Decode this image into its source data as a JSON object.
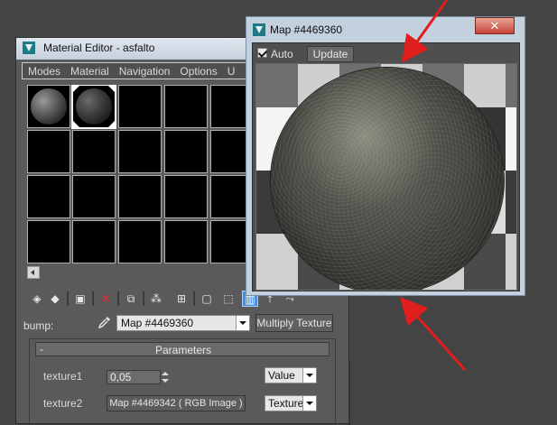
{
  "material_editor": {
    "title": "Material Editor - asfalto",
    "menu": [
      "Modes",
      "Material",
      "Navigation",
      "Options",
      "U"
    ],
    "bump_label": "bump:",
    "map_dropdown_value": "Map #4469360",
    "multiply_button": "Multiply Texture",
    "parameters": {
      "header_toggle": "-",
      "header_title": "Parameters",
      "texture1_label": "texture1",
      "texture1_value": "0,05",
      "texture1_mode": "Value",
      "texture2_label": "texture2",
      "texture2_map": "Map #4469342  ( RGB Image )",
      "texture2_mode": "Texture"
    }
  },
  "map_window": {
    "title": "Map #4469360",
    "close_glyph": "✕",
    "auto_label": "Auto",
    "auto_checked": true,
    "update_button": "Update"
  },
  "icons": {
    "eyedropper": "eyedropper-icon",
    "close": "close-icon"
  },
  "colors": {
    "annotation_arrow": "#e01e1e",
    "close_button": "#c6443a",
    "active_tool": "#4a90d9"
  }
}
